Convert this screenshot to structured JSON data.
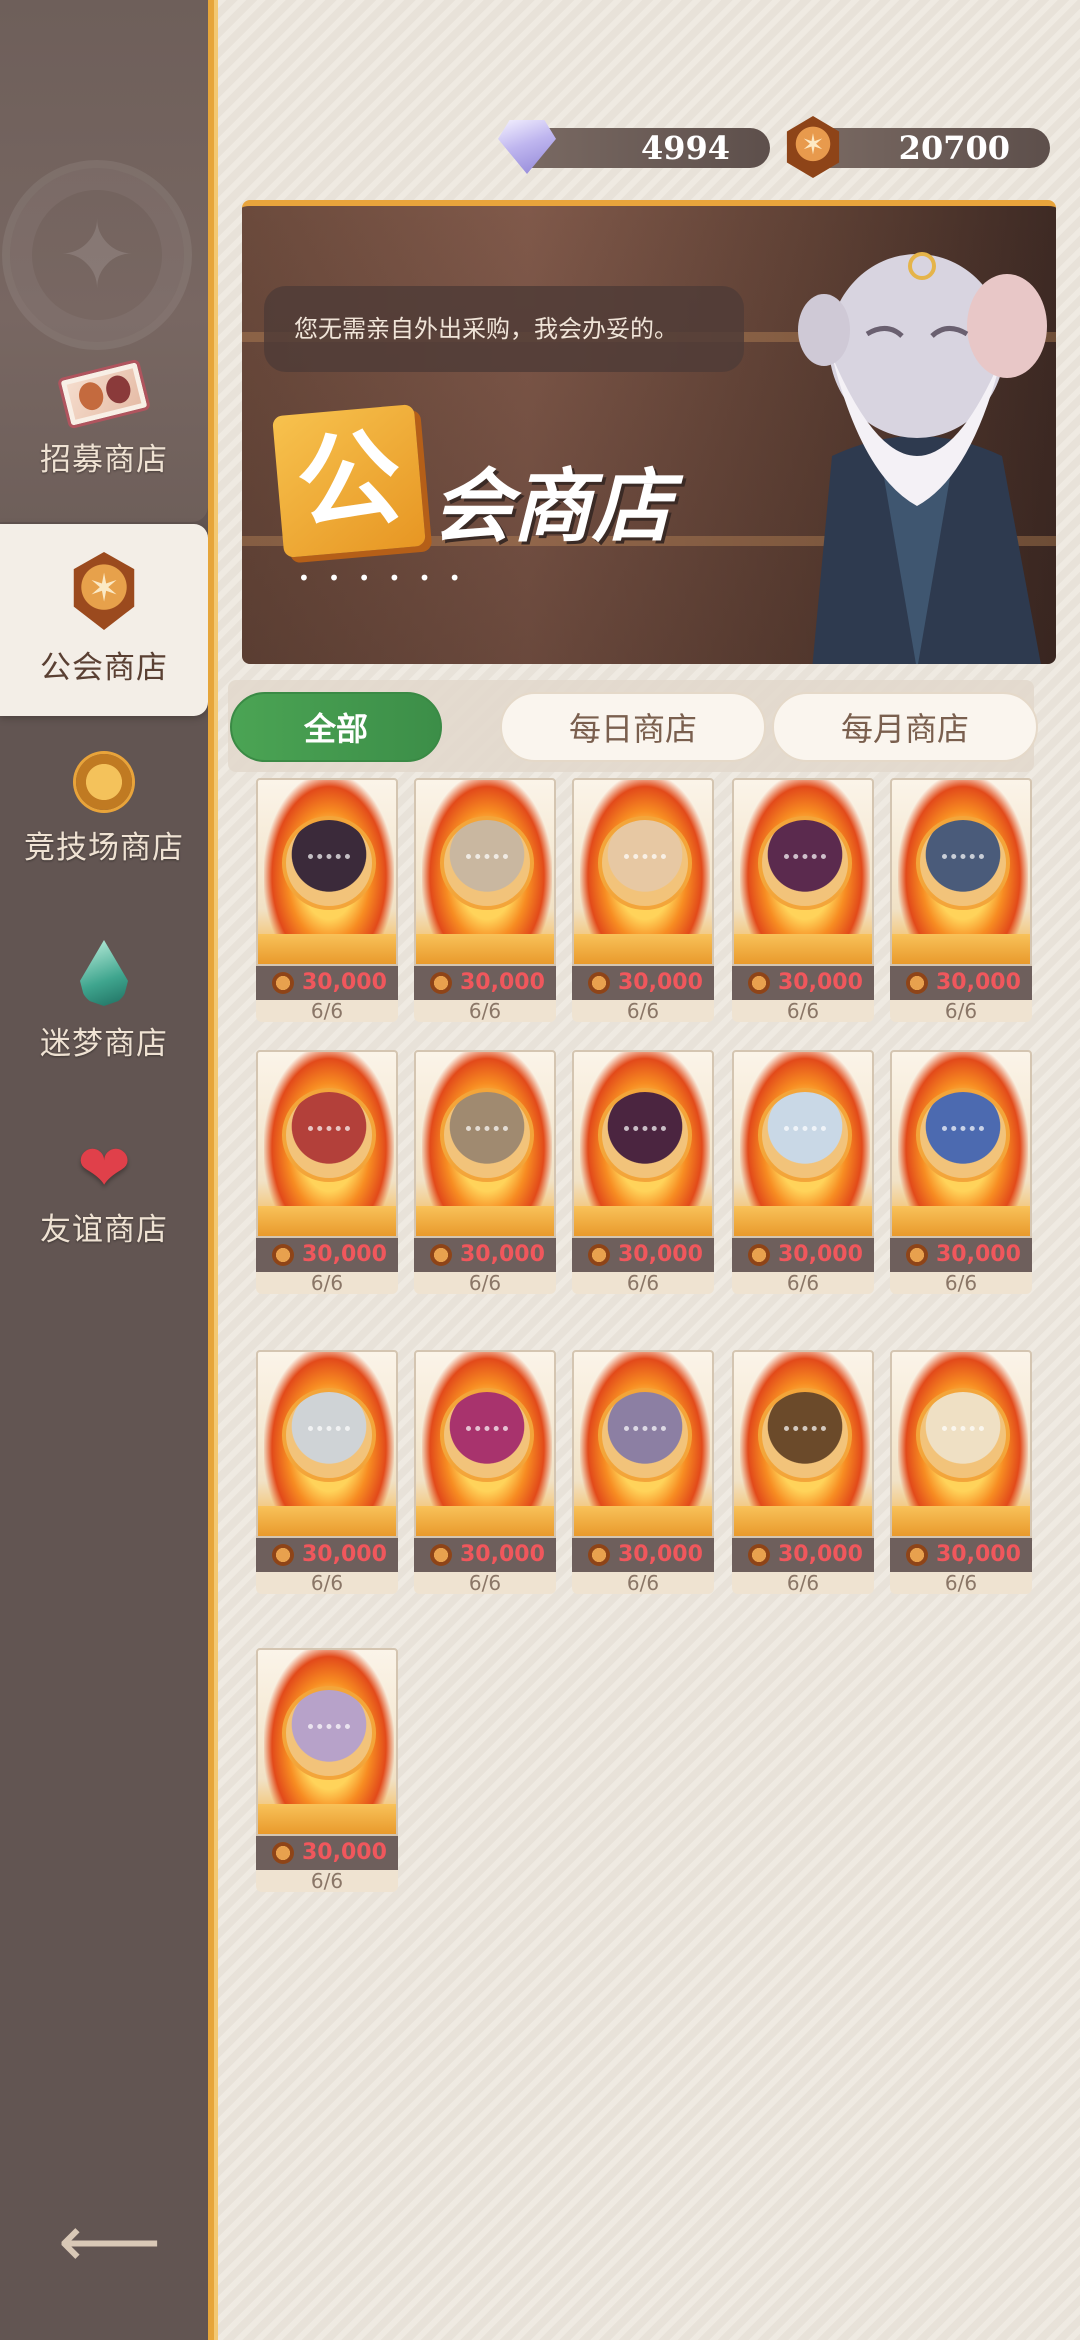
{
  "currencies": [
    {
      "name": "diamond",
      "icon": "diamond-icon",
      "value": "4994"
    },
    {
      "name": "guild-coin",
      "icon": "guild-coin-icon",
      "value": "20700"
    }
  ],
  "sidebar": {
    "items": [
      {
        "label": "招募商店",
        "icon": "recruit-ticket-icon"
      },
      {
        "label": "公会商店",
        "icon": "guild-emblem-icon",
        "active": true
      },
      {
        "label": "竞技场商店",
        "icon": "arena-medal-icon"
      },
      {
        "label": "迷梦商店",
        "icon": "dream-drop-icon"
      },
      {
        "label": "友谊商店",
        "icon": "heart-icon"
      }
    ],
    "back_icon": "back-arrow-icon"
  },
  "banner": {
    "speech": "您无需亲自外出采购，我会办妥的。",
    "emblem_char": "公",
    "title": "会商店",
    "dots": "• • • • • •"
  },
  "tabs": [
    {
      "label": "全部",
      "active": true
    },
    {
      "label": "每日商店",
      "active": false
    },
    {
      "label": "每月商店",
      "active": false
    }
  ],
  "items": [
    {
      "price": "30,000",
      "stock": "6/6",
      "color": "#3b2a3a"
    },
    {
      "price": "30,000",
      "stock": "6/6",
      "color": "#c9b7a0"
    },
    {
      "price": "30,000",
      "stock": "6/6",
      "color": "#e7c8a3"
    },
    {
      "price": "30,000",
      "stock": "6/6",
      "color": "#5b2a4e"
    },
    {
      "price": "30,000",
      "stock": "6/6",
      "color": "#4a5b7a"
    },
    {
      "price": "30,000",
      "stock": "6/6",
      "color": "#b3403a"
    },
    {
      "price": "30,000",
      "stock": "6/6",
      "color": "#a08a70"
    },
    {
      "price": "30,000",
      "stock": "6/6",
      "color": "#4b2540"
    },
    {
      "price": "30,000",
      "stock": "6/6",
      "color": "#c9d8e6"
    },
    {
      "price": "30,000",
      "stock": "6/6",
      "color": "#4c6ab0"
    },
    {
      "price": "30,000",
      "stock": "6/6",
      "color": "#cfd3d6"
    },
    {
      "price": "30,000",
      "stock": "6/6",
      "color": "#a8336d"
    },
    {
      "price": "30,000",
      "stock": "6/6",
      "color": "#8c7fa3"
    },
    {
      "price": "30,000",
      "stock": "6/6",
      "color": "#6b4a2a"
    },
    {
      "price": "30,000",
      "stock": "6/6",
      "color": "#efe0c4"
    },
    {
      "price": "30,000",
      "stock": "6/6",
      "color": "#b7a2c9"
    }
  ]
}
